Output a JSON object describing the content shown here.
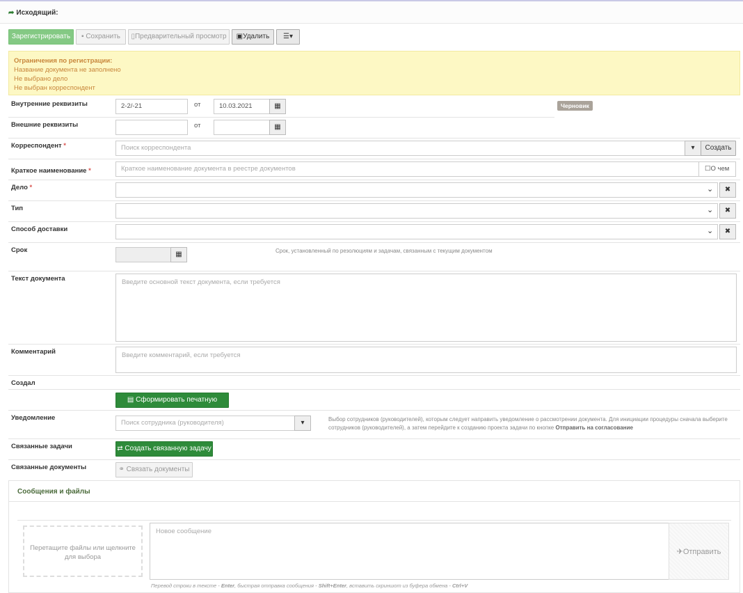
{
  "header": {
    "title": "Исходящий:"
  },
  "toolbar": {
    "register": "Зарегистрировать",
    "save": "Сохранить",
    "preview": "Предварительный просмотр",
    "delete": "Удалить"
  },
  "alert": {
    "title": "Ограничения по регистрации:",
    "lines": [
      "Название документа не заполнено",
      "Не выбрано дело",
      "Не выбран корреспондент"
    ]
  },
  "form": {
    "internal_label": "Внутренние реквизиты",
    "internal_number": "2-2/-21",
    "from": "от",
    "internal_date": "10.03.2021",
    "status_badge": "Черновик",
    "external_label": "Внешние реквизиты",
    "external_number": "",
    "external_date": "",
    "correspondent_label": "Корреспондент",
    "correspondent_placeholder": "Поиск корреспондента",
    "create": "Создать",
    "short_name_label": "Краткое наименование",
    "short_name_placeholder": "Краткое наименование документа в реестре документов",
    "about": "О чем",
    "case_label": "Дело",
    "type_label": "Тип",
    "delivery_label": "Способ доставки",
    "deadline_label": "Срок",
    "deadline_hint": "Срок, установленный по резолюциям и задачам, связанным с текущим документом",
    "text_label": "Текст документа",
    "text_placeholder": "Введите основной текст документа, если требуется",
    "comment_label": "Комментарий",
    "comment_placeholder": "Введите комментарий, если требуется",
    "created_label": "Создал",
    "print_form": "Сформировать печатную форму",
    "notify_label": "Уведомление",
    "notify_placeholder": "Поиск сотрудника (руководителя)",
    "notify_hint": "Выбор сотрудников (руководителей), которым следует направить уведомление о рассмотрении документа. Для инициации процедуры сначала выберите сотрудников (руководителей), а затем перейдите к созданию проекта задачи по кнопке",
    "notify_hint_bold": "Отправить на согласование",
    "linked_tasks_label": "Связанные задачи",
    "create_linked_task": "Создать связанную задачу",
    "linked_docs_label": "Связанные документы",
    "link_docs": "Связать документы"
  },
  "messages": {
    "title": "Сообщения и файлы",
    "dropzone": "Перетащите файлы или щелкните для выбора",
    "new_message_placeholder": "Новое сообщение",
    "send": "Отправить",
    "foot_1": "Перевод строки в тексте - ",
    "foot_enter": "Enter",
    "foot_2": ", быстрая отправка сообщения - ",
    "foot_shift": "Shift+Enter",
    "foot_3": ", вставить скриншот из буфера обмена - ",
    "foot_ctrl": "Ctrl+V"
  }
}
